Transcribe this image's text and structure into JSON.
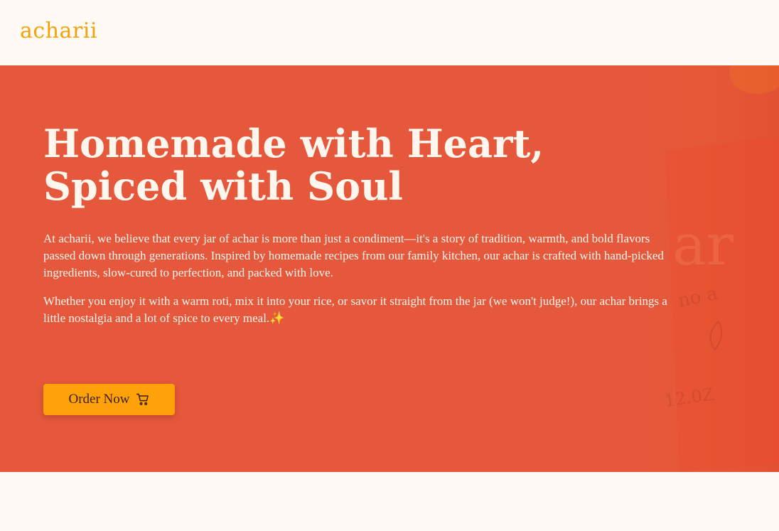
{
  "brand": {
    "logo_text": "acharii",
    "accent_color": "#f5a20a"
  },
  "hero": {
    "title_line1": "Homemade with Heart,",
    "title_line2": "Spiced with Soul",
    "paragraph1": "At acharii, we believe that every jar of achar is more than just a condiment—it's a story of tradition, warmth, and bold flavors passed down through generations. Inspired by homemade recipes from our family kitchen, our achar is crafted with hand-picked ingredients, slow-cured to perfection, and packed with love.",
    "paragraph2": "Whether you enjoy it with a warm roti, mix it into your rice, or savor it straight from the jar (we won't judge!), our achar brings a little nostalgia and a lot of spice to every meal.",
    "sparkle_emoji": "✨",
    "background_color": "#e6583b",
    "cta": {
      "label": "Order Now",
      "icon": "cart-icon",
      "color": "#ffa20a"
    }
  }
}
